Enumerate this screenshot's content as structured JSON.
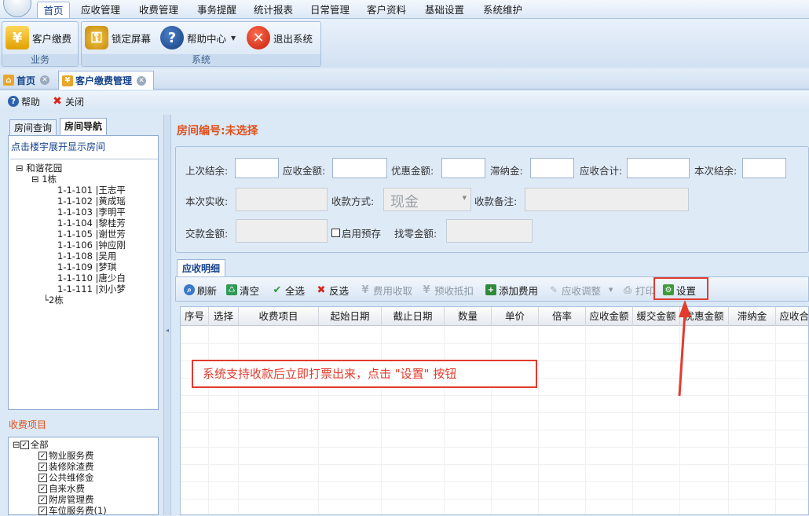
{
  "menu": {
    "items": [
      "首页",
      "应收管理",
      "收费管理",
      "事务提醒",
      "统计报表",
      "日常管理",
      "客户资料",
      "基础设置",
      "系统维护"
    ],
    "active_index": 0
  },
  "ribbon": {
    "group_business": {
      "title": "业务",
      "buttons": [
        {
          "label": "客户缴费",
          "icon": "yen-coin-icon"
        }
      ]
    },
    "group_system": {
      "title": "系统",
      "buttons": [
        {
          "label": "锁定屏幕",
          "icon": "lock-users-icon"
        },
        {
          "label": "帮助中心",
          "icon": "help-icon"
        },
        {
          "label": "退出系统",
          "icon": "exit-icon"
        }
      ]
    }
  },
  "doc_tabs": [
    {
      "label": "首页",
      "icon": "home-icon"
    },
    {
      "label": "客户缴费管理",
      "icon": "yen-icon"
    }
  ],
  "subtoolbar": {
    "help": "帮助",
    "close": "关闭"
  },
  "left": {
    "tabs": [
      "房间查询",
      "房间导航"
    ],
    "active_tab": 1,
    "tree_hint": "点击楼宇展开显示房间",
    "tree": {
      "root": "和谐花园",
      "building1": "1栋",
      "rooms": [
        "1-1-101 |王志平",
        "1-1-102 |黄成瑶",
        "1-1-103 |李明平",
        "1-1-104 |黎桂芳",
        "1-1-105 |谢世芳",
        "1-1-106 |钟应刚",
        "1-1-108 |吴用",
        "1-1-109 |梦琪",
        "1-1-110 |唐少白",
        "1-1-111 |刘小梦"
      ],
      "building2": "2栋"
    },
    "fee_section_title": "收费项目",
    "fee_root": "全部",
    "fee_items": [
      "物业服务费",
      "装修除渣费",
      "公共维修金",
      "自来水费",
      "附房管理费",
      "车位服务费(1)"
    ]
  },
  "room": {
    "label": "房间编号:",
    "value": "未选择"
  },
  "form": {
    "row1": [
      "上次结余:",
      "应收金额:",
      "优惠金额:",
      "滞纳金:",
      "应收合计:",
      "本次结余:"
    ],
    "actual_label": "本次实收:",
    "pay_method_label": "收款方式:",
    "pay_method_value": "现金",
    "remark_label": "收款备注:",
    "pay_amount_label": "交款金额:",
    "prepay_label": "启用预存",
    "change_label": "找零金额:"
  },
  "detail": {
    "tab_label": "应收明细",
    "toolbar": [
      {
        "label": "刷新",
        "icon": "search-icon",
        "enabled": true
      },
      {
        "label": "清空",
        "icon": "clear-icon",
        "enabled": true
      },
      {
        "label": "全选",
        "icon": "check-icon",
        "enabled": true
      },
      {
        "label": "反选",
        "icon": "cross-icon",
        "enabled": true
      },
      {
        "label": "费用收取",
        "icon": "yen-icon",
        "enabled": false
      },
      {
        "label": "预收抵扣",
        "icon": "yen-icon",
        "enabled": false
      },
      {
        "label": "添加费用",
        "icon": "add-icon",
        "enabled": true
      },
      {
        "label": "应收调整",
        "icon": "edit-icon",
        "enabled": false
      },
      {
        "label": "打印",
        "icon": "printer-icon",
        "enabled": false
      },
      {
        "label": "设置",
        "icon": "settings-icon",
        "enabled": true
      }
    ],
    "columns": [
      "序号",
      "选择",
      "收费项目",
      "起始日期",
      "截止日期",
      "数量",
      "单价",
      "倍率",
      "应收金额",
      "缓交金额",
      "优惠金额",
      "滞纳金",
      "应收合计"
    ]
  },
  "annotation": {
    "text": "系统支持收款后立即打票出来，点击 \"设置\" 按钮",
    "color": "#e23b2e"
  },
  "colors": {
    "accent": "#15428b",
    "title_orange": "#e0511b",
    "highlight_red": "#e23b2e"
  }
}
